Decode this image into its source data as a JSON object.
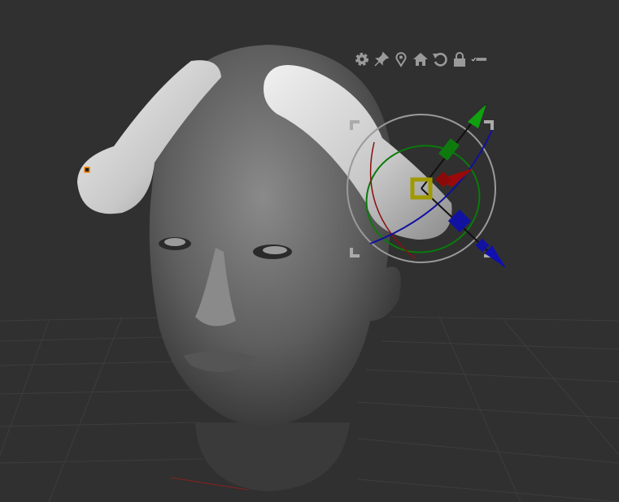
{
  "viewport": {
    "background": "#303030",
    "model": "female-head-with-horn-shapes"
  },
  "gizmo_toolbar": {
    "icons": [
      "gear-icon",
      "pin-icon",
      "location-icon",
      "home-icon",
      "reset-icon",
      "lock-icon",
      "toggle-icon"
    ]
  },
  "gizmo": {
    "colors": {
      "x": "#a00000",
      "y": "#00a000",
      "z": "#0000b0",
      "center": "#a09a00",
      "ring": "#9a9a9a"
    }
  }
}
